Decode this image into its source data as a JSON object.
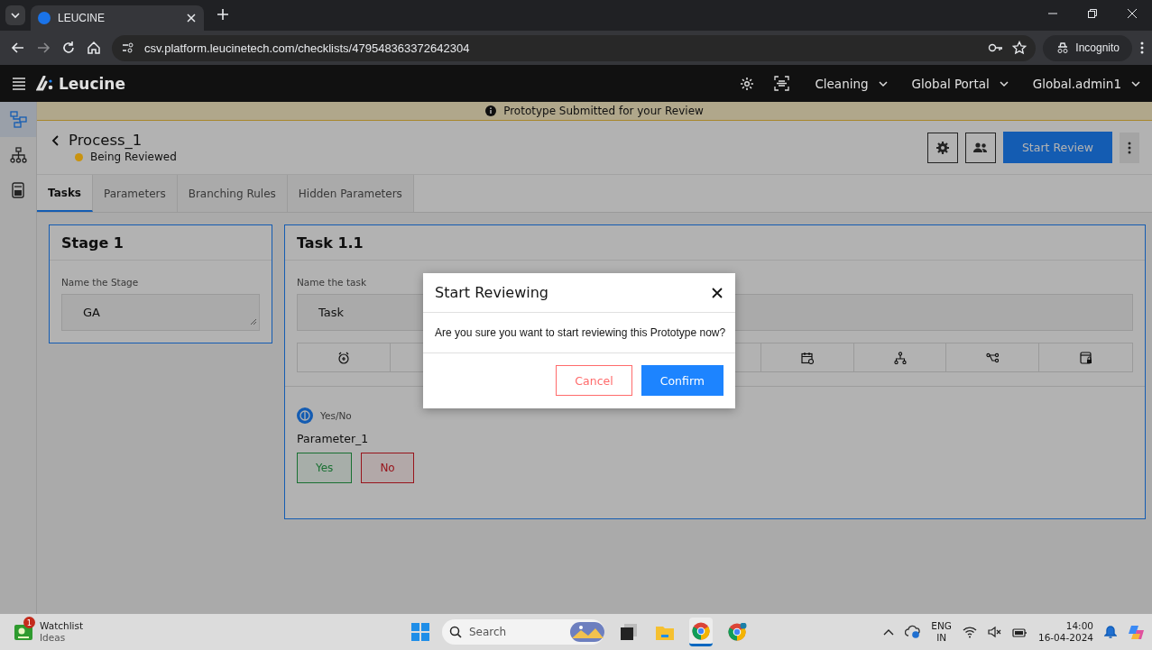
{
  "browser": {
    "tab_title": "LEUCINE",
    "url": "csv.platform.leucinetech.com/checklists/479548363372642304",
    "profile_label": "Incognito"
  },
  "header": {
    "brand": "Leucine",
    "menus": [
      {
        "label": "Cleaning"
      },
      {
        "label": "Global Portal"
      },
      {
        "label": "Global.admin1"
      }
    ]
  },
  "sidebar": {
    "items": [
      {
        "selected": true
      },
      {
        "selected": false
      },
      {
        "selected": false
      }
    ]
  },
  "banner": {
    "text": "Prototype Submitted for your Review"
  },
  "process": {
    "title": "Process_1",
    "status": {
      "label": "Being Reviewed",
      "color": "#c9930f"
    },
    "primary_button": "Start Review"
  },
  "tabs": [
    {
      "label": "Tasks",
      "selected": true
    },
    {
      "label": "Parameters",
      "selected": false
    },
    {
      "label": "Branching Rules",
      "selected": false
    },
    {
      "label": "Hidden Parameters",
      "selected": false
    }
  ],
  "stage": {
    "title": "Stage 1",
    "field_label": "Name the Stage",
    "value": "GA"
  },
  "task": {
    "title": "Task 1.1",
    "field_label": "Name the task",
    "value": "Task",
    "parameter": {
      "type_label": "Yes/No",
      "name": "Parameter_1",
      "options": [
        {
          "label": "Yes",
          "kind": "yes"
        },
        {
          "label": "No",
          "kind": "no"
        }
      ]
    }
  },
  "dialog": {
    "title": "Start Reviewing",
    "message": "Are you sure you want to start reviewing this Prototype now?",
    "buttons": [
      {
        "label": "Cancel",
        "kind": "secondary"
      },
      {
        "label": "Confirm",
        "kind": "primary"
      }
    ]
  },
  "taskbar": {
    "widget": {
      "badge": "1",
      "title": "Watchlist",
      "subtitle": "Ideas"
    },
    "search_placeholder": "Search",
    "language": "ENG",
    "region": "IN",
    "time": "14:00",
    "date": "16-04-2024"
  }
}
